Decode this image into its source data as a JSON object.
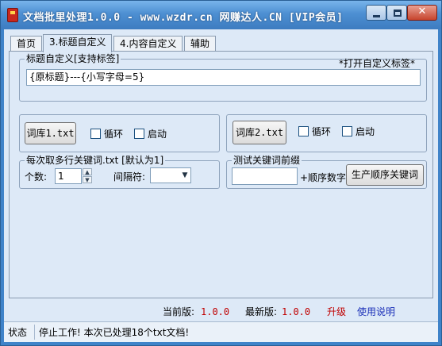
{
  "window": {
    "title": "文档批里处理1.0.0 - www.wzdr.cn 网赚达人.CN [VIP会员]",
    "close_label": "✕"
  },
  "tabs": [
    {
      "label": "首页",
      "active": false
    },
    {
      "label": "3.标题自定义",
      "active": true
    },
    {
      "label": "4.内容自定义",
      "active": false
    },
    {
      "label": "辅助",
      "active": false
    }
  ],
  "title_group": {
    "label": "标题自定义[支持标签]",
    "open_custom_tags": "*打开自定义标签*",
    "template_value": "{原标题}---{小写字母=5}"
  },
  "lexicon1": {
    "button": "词库1.txt",
    "loop_label": "循环",
    "enable_label": "启动",
    "loop_checked": false,
    "enable_checked": false
  },
  "lexicon2": {
    "button": "词库2.txt",
    "loop_label": "循环",
    "enable_label": "启动",
    "loop_checked": false,
    "enable_checked": false
  },
  "multi_keyword": {
    "label": "每次取多行关键词.txt [默认为1]",
    "count_label": "个数:",
    "count_value": "1",
    "separator_label": "间隔符:",
    "separator_value": ""
  },
  "test_prefix": {
    "label": "测试关键词前缀",
    "prefix_value": "",
    "suffix_label": "+顺序数字",
    "generate_button": "生产顺序关键词"
  },
  "version": {
    "current_label": "当前版:",
    "current_value": "1.0.0",
    "latest_label": "最新版:",
    "latest_value": "1.0.0",
    "upgrade_link": "升级",
    "help_link": "使用说明"
  },
  "status": {
    "label": "状态",
    "message": "停止工作! 本次已处理18个txt文档!"
  },
  "colors": {
    "version_value": "#c00000",
    "upgrade": "#c00000",
    "help": "#1a2fb8",
    "client_bg": "#dde9f7"
  }
}
